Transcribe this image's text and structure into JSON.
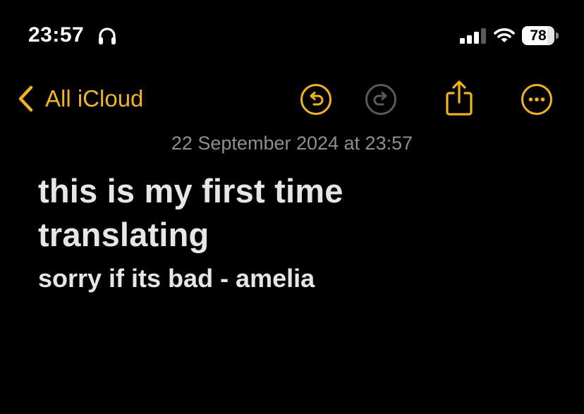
{
  "status_bar": {
    "time": "23:57",
    "headphones_icon": "headphones-icon",
    "signal_icon": "cellular-signal-icon",
    "wifi_icon": "wifi-icon",
    "battery_level": "78",
    "battery_fraction": 0.78
  },
  "nav": {
    "back_label": "All iCloud",
    "back_icon": "chevron-left-icon",
    "undo_icon": "undo-icon",
    "redo_icon": "redo-icon",
    "share_icon": "share-icon",
    "more_icon": "more-icon"
  },
  "note": {
    "date": "22 September 2024 at 23:57",
    "title_lines": [
      "this is my first time",
      "translating"
    ],
    "subtitle": "sorry if its bad - amelia"
  },
  "colors": {
    "accent": "#f0b323",
    "background": "#000000",
    "text": "#e6e6e6",
    "secondary_text": "#8e8e93",
    "disabled_icon": "#5a5a5e"
  }
}
